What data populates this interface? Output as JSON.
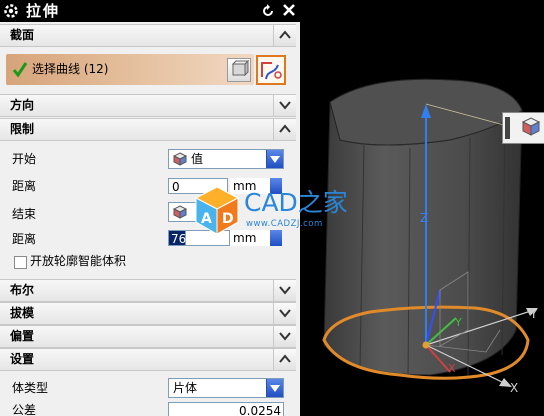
{
  "title": "拉伸",
  "sections": {
    "section": "截面",
    "direction": "方向",
    "limits": "限制",
    "boolean": "布尔",
    "draft": "拔模",
    "offset": "偏置",
    "settings": "设置"
  },
  "select_curve": {
    "label": "选择曲线 (12)"
  },
  "limits": {
    "start_label": "开始",
    "start_value": "值",
    "start_distance_label": "距离",
    "start_distance": "0",
    "start_unit": "mm",
    "end_label": "结束",
    "end_distance_label": "距离",
    "end_distance": "76",
    "end_unit": "mm",
    "open_profile_label": "开放轮廓智能体积"
  },
  "settings": {
    "body_type_label": "体类型",
    "body_type_value": "片体",
    "tolerance_label": "公差",
    "tolerance_value": "0.0254"
  },
  "watermark": {
    "title": "CAD之家",
    "url": "www.CADZJ.com"
  },
  "axes": {
    "x": "X",
    "y": "Y",
    "z": "Z"
  },
  "colors": {
    "title_bg": "#000000",
    "accent_orange": "#e07820",
    "watermark_blue": "#2a86d8",
    "combo_blue": "#2f5fd0"
  }
}
